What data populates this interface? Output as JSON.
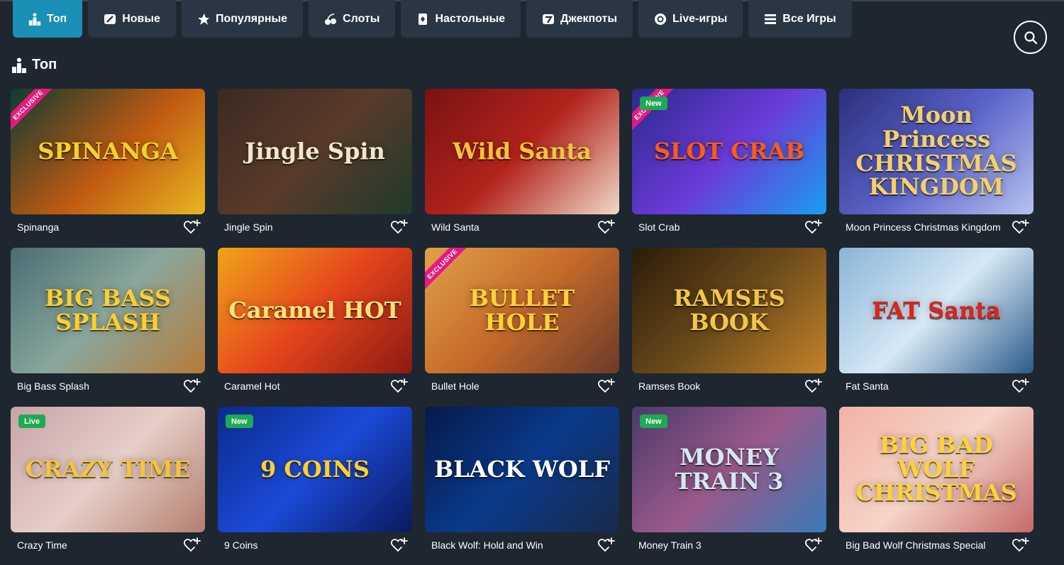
{
  "tabs": [
    {
      "label": "Топ",
      "icon": "podium-icon",
      "active": true
    },
    {
      "label": "Новые",
      "icon": "new-tag-icon"
    },
    {
      "label": "Популярные",
      "icon": "star-burst-icon"
    },
    {
      "label": "Слоты",
      "icon": "cherries-icon"
    },
    {
      "label": "Настольные",
      "icon": "playing-card-icon"
    },
    {
      "label": "Джекпоты",
      "icon": "jackpot-seven-icon"
    },
    {
      "label": "Live-игры",
      "icon": "roulette-chip-icon"
    },
    {
      "label": "Все Игры",
      "icon": "list-icon"
    }
  ],
  "search": {
    "icon": "search-icon"
  },
  "section": {
    "title": "Топ",
    "icon": "podium-icon"
  },
  "games": [
    {
      "title": "Spinanga",
      "art": "SPINANGA",
      "ribbon": "EXCLUSIVE",
      "bg": "linear-gradient(135deg,#0f3b2f,#c25a12 55%,#e8b720)",
      "art_color": "#f5d12a"
    },
    {
      "title": "Jingle Spin",
      "art": "Jingle Spin",
      "bg": "linear-gradient(135deg,#3a2a22,#5a3b2b 50%,#1f3a2a)",
      "art_color": "#f1e6c8"
    },
    {
      "title": "Wild Santa",
      "art": "Wild Santa",
      "bg": "linear-gradient(135deg,#7a1212,#b2241c 50%,#f0d9c8)",
      "art_color": "#f6c23a"
    },
    {
      "title": "Slot Crab",
      "art": "SLOT CRAB",
      "ribbon": "EXCLUSIVE",
      "badge": "New",
      "bg": "linear-gradient(135deg,#2b2a8a,#6a3ad8 50%,#1a9ef0)",
      "art_color": "#ff5a1a"
    },
    {
      "title": "Moon Princess Christmas Kingdom",
      "art": "Moon Princess CHRISTMAS KINGDOM",
      "bg": "linear-gradient(135deg,#2b2f7a,#5b63c9 50%,#b7c2ee)",
      "art_color": "#f3d16a"
    },
    {
      "title": "Big Bass Splash",
      "art": "BIG BASS SPLASH",
      "bg": "linear-gradient(135deg,#4a6d73,#8aa79c 50%,#b77a3a)",
      "art_color": "#ffcf2a"
    },
    {
      "title": "Caramel Hot",
      "art": "Caramel HOT",
      "bg": "linear-gradient(135deg,#f0a41a,#e5451c 50%,#8c1a12)",
      "art_color": "#ffe27a"
    },
    {
      "title": "Bullet Hole",
      "art": "BULLET HOLE",
      "ribbon": "EXCLUSIVE",
      "bg": "linear-gradient(135deg,#e0a04a,#c46a2a 50%,#6a3a2a)",
      "art_color": "#ffd23a"
    },
    {
      "title": "Ramses Book",
      "art": "RAMSES BOOK",
      "bg": "linear-gradient(135deg,#2a1c0a,#6a4a1a 50%,#c4822a)",
      "art_color": "#f3c64a"
    },
    {
      "title": "Fat Santa",
      "art": "FAT Santa",
      "bg": "linear-gradient(135deg,#8ab4d8,#d6e8f4 50%,#2b5a8a)",
      "art_color": "#e2221a"
    },
    {
      "title": "Crazy Time",
      "art": "CRAZY TIME",
      "badge": "Live",
      "bg": "linear-gradient(135deg,#c7a3a8,#e6cfc8 50%,#b37f70)",
      "art_color": "#f5c43a"
    },
    {
      "title": "9 Coins",
      "art": "9 COINS",
      "badge": "New",
      "bg": "linear-gradient(135deg,#0b2a8a,#1b4ad8 50%,#0a1a5a)",
      "art_color": "#ffcf2a"
    },
    {
      "title": "Black Wolf: Hold and Win",
      "art": "BLACK WOLF",
      "bg": "linear-gradient(135deg,#061a4a,#0a3a8a 50%,#1a2a4a)",
      "art_color": "#ffffff"
    },
    {
      "title": "Money Train 3",
      "art": "MONEY TRAIN 3",
      "badge": "New",
      "bg": "linear-gradient(135deg,#4a3a6a,#9a5a8a 50%,#3a7ab8)",
      "art_color": "#d6e6f2"
    },
    {
      "title": "Big Bad Wolf Christmas Special",
      "art": "BIG BAD WOLF CHRISTMAS",
      "bg": "linear-gradient(135deg,#f2b2a8,#f6d4c8 50%,#c46a6a)",
      "art_color": "#ffd23a"
    }
  ],
  "colors": {
    "background": "#1e2630",
    "tab": "#2b3644",
    "tab_active": "#1b8fb5",
    "badge_new": "#1eaa55",
    "ribbon_exclusive": "#e21b82"
  }
}
